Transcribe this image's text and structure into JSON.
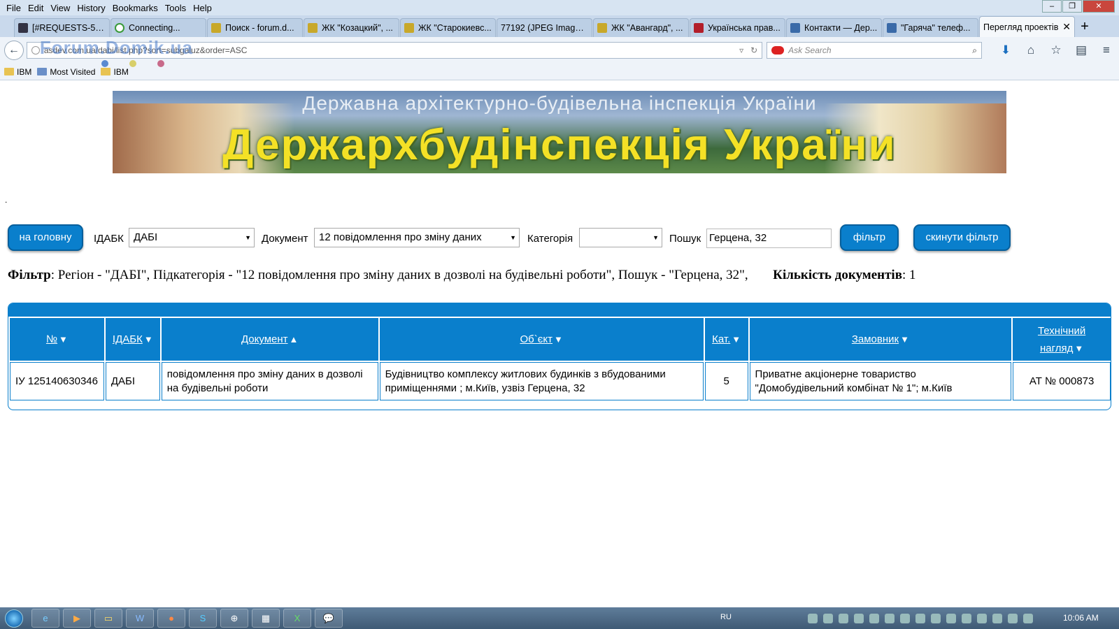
{
  "menu": [
    "File",
    "Edit",
    "View",
    "History",
    "Bookmarks",
    "Tools",
    "Help"
  ],
  "tabs": [
    {
      "label": "[#REQUESTS-566...",
      "active": false
    },
    {
      "label": "Connecting...",
      "active": false
    },
    {
      "label": "Поиск - forum.d...",
      "active": false
    },
    {
      "label": "ЖК \"Козацкий\", ...",
      "active": false
    },
    {
      "label": "ЖК \"Старокиевс...",
      "active": false
    },
    {
      "label": "77192 (JPEG Image, 1...",
      "active": false
    },
    {
      "label": "ЖК \"Авангард\", ...",
      "active": false
    },
    {
      "label": "Українська прав...",
      "active": false
    },
    {
      "label": "Контакти — Дер...",
      "active": false
    },
    {
      "label": "\"Гаряча\" телеф...",
      "active": false
    },
    {
      "label": "Перегляд проектів",
      "active": true
    }
  ],
  "url": "asdev.com.ua/dabi/list.php?sort=subgaluz&order=ASC",
  "url_watermark": "Forum.Domik.ua",
  "search_placeholder": "Ask Search",
  "bookmarks": [
    "IBM",
    "Most Visited",
    "IBM"
  ],
  "banner": {
    "line1": "Державна архітектурно-будівельна інспекція України",
    "line2": "Держархбудінспекція України"
  },
  "dot": ".",
  "controls": {
    "home_button": "на головну",
    "idabk_label": "ІДАБК",
    "idabk_value": "ДАБІ",
    "doc_label": "Документ",
    "doc_value": "12 повідомлення про зміну даних",
    "cat_label": "Категорія",
    "cat_value": "",
    "search_label": "Пошук",
    "search_value": "Герцена, 32",
    "filter_button": "фільтр",
    "reset_button": "скинути фільтр"
  },
  "filter_line": {
    "label": "Фільтр",
    "text": ": Регіон - \"ДАБІ\", Підкатегорія - \"12 повідомлення про зміну даних в дозволі на будівельні роботи\", Пошук - \"Герцена, 32\",",
    "count_label": "Кількість документів",
    "count_value": ": 1"
  },
  "table": {
    "headers": [
      "№",
      "ІДАБК",
      "Документ",
      "Об`єкт",
      "Кат.",
      "Замовник",
      "Технічний нагляд"
    ],
    "rows": [
      [
        "ІУ 125140630346",
        "ДАБІ",
        "повідомлення про зміну даних в дозволі на будівельні роботи",
        "Будівництво комплексу житлових будинків з вбудованими приміщеннями ; м.Київ, узвіз Герцена, 32",
        "5",
        "Приватне акціонерне товариство \"Домобудівельний комбінат № 1\"; м.Київ",
        "АТ № 000873"
      ]
    ]
  },
  "taskbar": {
    "lang": "RU",
    "clock": "10:06 AM"
  },
  "colors": {
    "accent": "#0a7fcc",
    "banner_text": "#f4e126"
  }
}
